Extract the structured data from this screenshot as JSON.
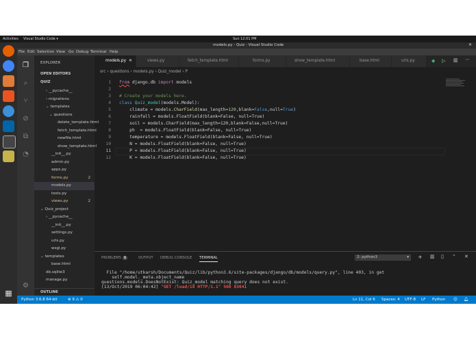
{
  "topbar": {
    "activities": "Activities",
    "app": "Visual Studio Code ▾",
    "clock": "Sun 12:01 PM"
  },
  "window": {
    "title": "models.py - Quiz - Visual Studio Code"
  },
  "menu": [
    "File",
    "Edit",
    "Selection",
    "View",
    "Go",
    "Debug",
    "Terminal",
    "Help"
  ],
  "sidebar": {
    "header": "EXPLORER",
    "open_editors": "OPEN EDITORS",
    "quiz": "QUIZ",
    "outline": "OUTLINE",
    "items": [
      {
        "label": "› __pycache__"
      },
      {
        "label": "› migrations"
      },
      {
        "label": "⌄ templates"
      },
      {
        "label": "⌄ questions"
      },
      {
        "label": "delete_template.html"
      },
      {
        "label": "fetch_template.html"
      },
      {
        "label": "newfile.html"
      },
      {
        "label": "show_template.html"
      },
      {
        "label": "__init__.py"
      },
      {
        "label": "admin.py"
      },
      {
        "label": "apps.py"
      },
      {
        "label": "forms.py",
        "badge": "2"
      },
      {
        "label": "models.py"
      },
      {
        "label": "tests.py"
      },
      {
        "label": "views.py",
        "badge": "2"
      },
      {
        "label": "⌄ Quiz_project"
      },
      {
        "label": "› __pycache__"
      },
      {
        "label": "__init__.py"
      },
      {
        "label": "settings.py"
      },
      {
        "label": "urls.py"
      },
      {
        "label": "wsgi.py"
      },
      {
        "label": "⌄ templates"
      },
      {
        "label": "base.html"
      },
      {
        "label": "db.sqlite3"
      },
      {
        "label": "manage.py"
      }
    ]
  },
  "tabs": [
    "models.py",
    "views.py",
    "fetch_template.html",
    "forms.py",
    "show_template.html",
    "base.html",
    "urls.py"
  ],
  "breadcrumb": "src › questions › models.py › Quiz_model › P",
  "code": {
    "lines": [
      "1",
      "2",
      "3",
      "4",
      "5",
      "6",
      "7",
      "8",
      "9",
      "10",
      "11",
      "12"
    ],
    "l1a": "from",
    "l1b": " django.db ",
    "l1c": "import",
    "l1d": " models",
    "l3": "# Create your models here.",
    "l4a": "class ",
    "l4b": "Quiz_model",
    "l4c": "(models.Model):",
    "l5a": "    climate = models.",
    "l5b": "CharField",
    "l5c": "(max_length=",
    "l5d": "120",
    ",l5e": "",
    "l5f": ",blank=",
    "l5g": "False",
    ",l5h": "",
    "l5i": ",null=",
    "l5j": "True",
    "l5k": ")",
    "l6": "    rainfall = models.FloatField(blank=False, null=True)",
    "l7": "    soil = models.CharField(max_length=120,blank=False,null=True)",
    "l8": "    ph  = models.FloatField(blank=False, null=True)",
    "l9": "    temperature = models.FloatField(blank=False, null=True)",
    "l10": "    N = models.FloatField(blank=False, null=True)",
    "l11": "    P = models.FloatField(blank=False, null=True)",
    "l12": "    K = models.FloatField(blank=False, null=True)"
  },
  "panel": {
    "problems": "PROBLEMS",
    "problems_count": "9",
    "output": "OUTPUT",
    "debug": "DEBUG CONSOLE",
    "terminal": "TERMINAL",
    "selector": "2: python3",
    "t1": "  File \"/home/utkarsh/Documents/Quiz/lib/python3.6/site-packages/django/db/models/query.py\", line 403, in get",
    "t2": "    self.model._meta.object_name",
    "t3": "questions.models.DoesNotExist: Quiz_model matching query does not exist.",
    "t4a": "[13/Oct/2019 06:04:42] ",
    "t4b": "\"GET /load/18 HTTP/1.1\" 500 83041"
  },
  "status": {
    "python": "Python 3.6.8 64-bit",
    "errors": "⊗ 9 ⚠ 0",
    "position": "Ln 11, Col 6",
    "spaces": "Spaces: 4",
    "encoding": "UTF-8",
    "eol": "LF",
    "lang": "Python"
  }
}
